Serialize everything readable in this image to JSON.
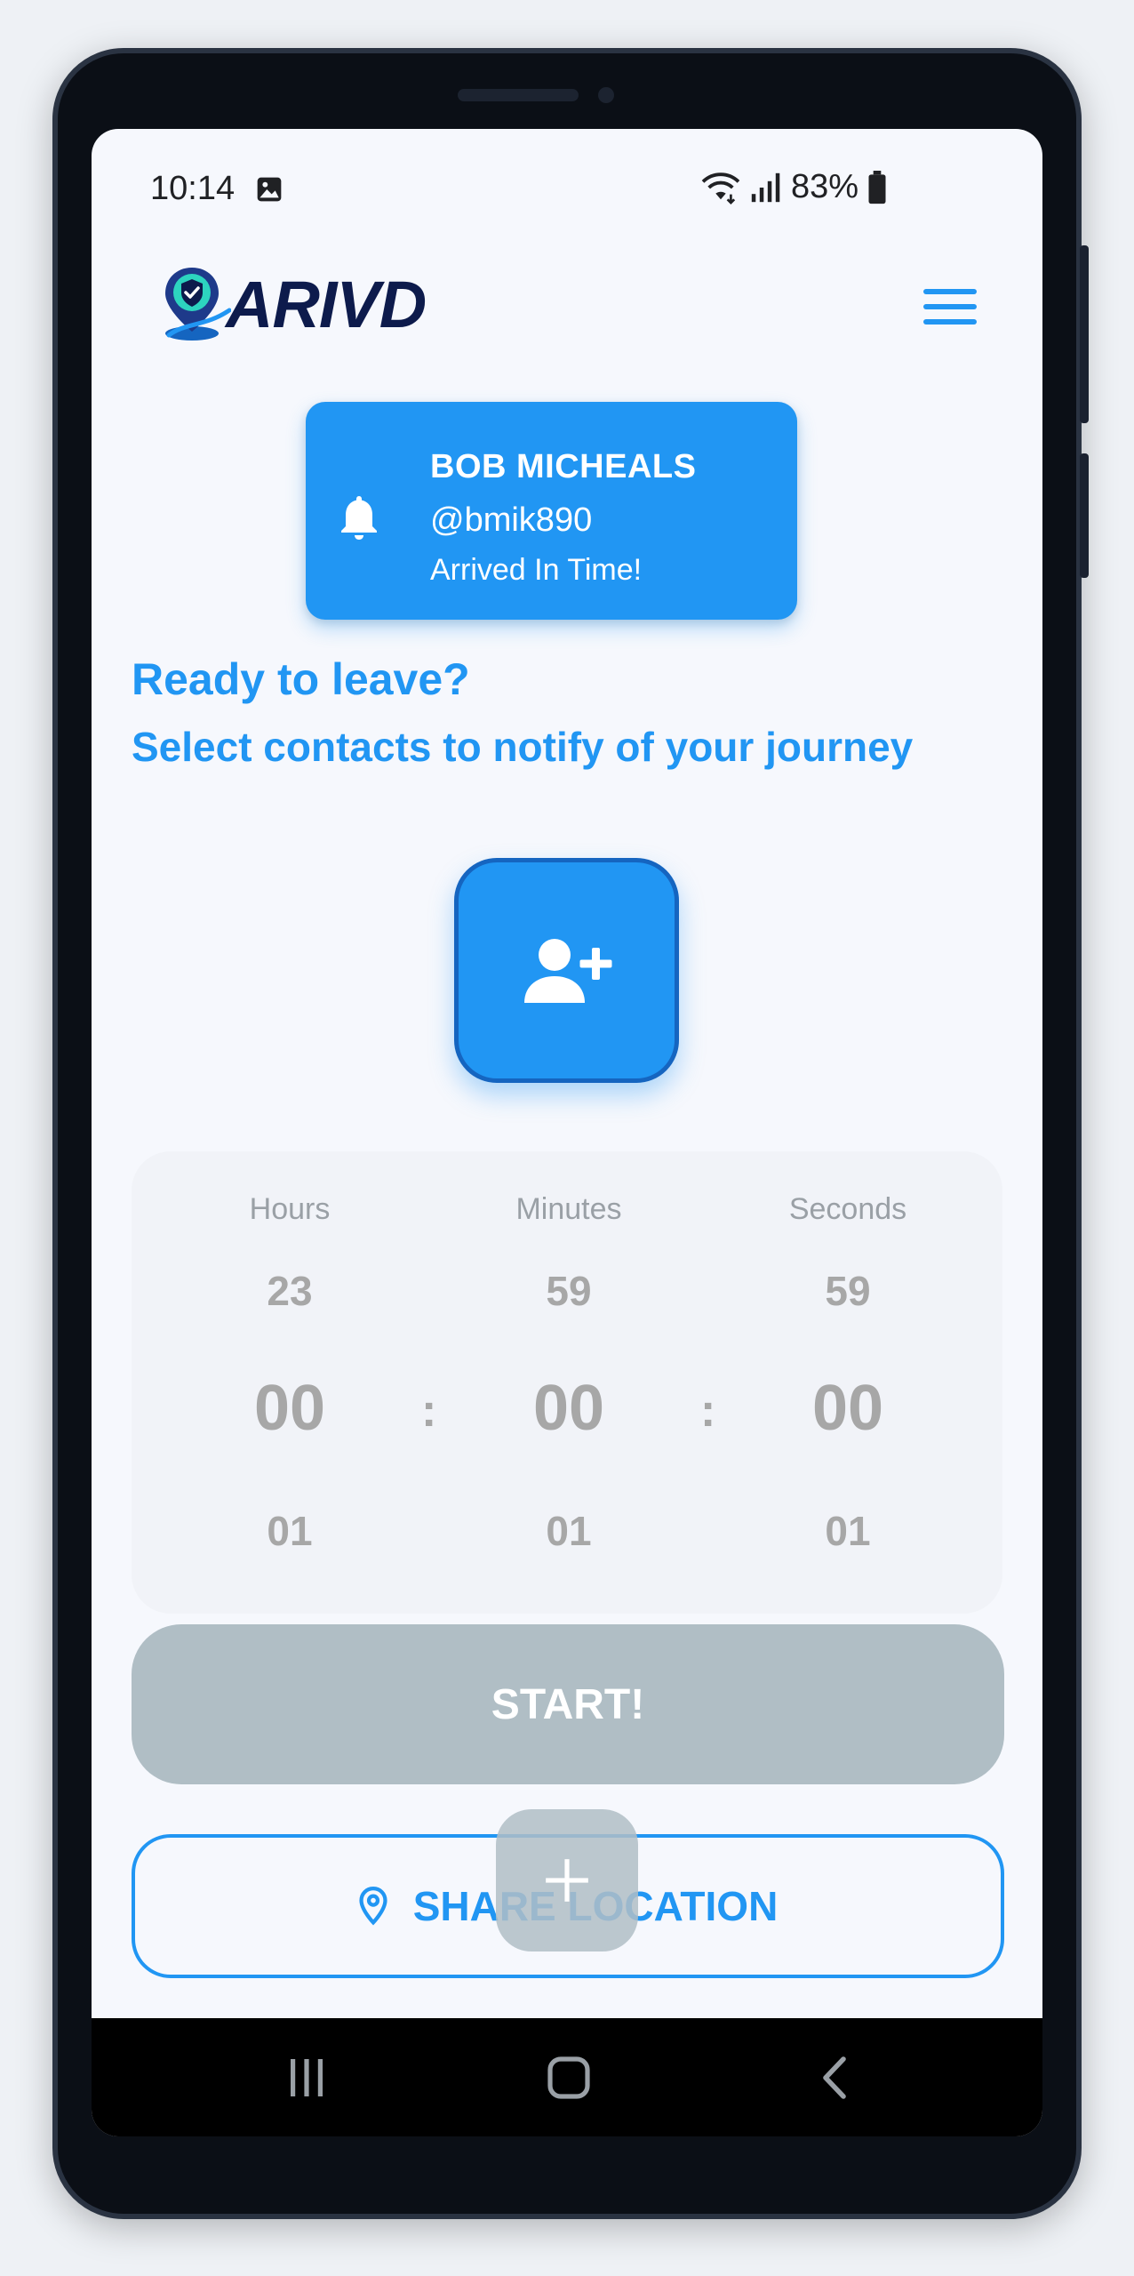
{
  "status_bar": {
    "time": "10:14",
    "battery": "83%",
    "icons": [
      "image-icon",
      "wifi-icon",
      "signal-icon",
      "battery-icon"
    ]
  },
  "app": {
    "logo_text": "ARIVD",
    "menu_icon": "hamburger-menu-icon"
  },
  "notification": {
    "name": "BOB MICHEALS",
    "handle": "@bmik890",
    "status": "Arrived In Time!",
    "icon": "bell-icon"
  },
  "main": {
    "heading": "Ready to leave?",
    "subheading": "Select contacts to notify of your journey",
    "add_contact_icon": "person-add-icon"
  },
  "timer": {
    "columns": [
      {
        "label": "Hours",
        "prev": "23",
        "current": "00",
        "next": "01"
      },
      {
        "label": "Minutes",
        "prev": "59",
        "current": "00",
        "next": "01"
      },
      {
        "label": "Seconds",
        "prev": "59",
        "current": "00",
        "next": "01"
      }
    ],
    "separator": ":"
  },
  "actions": {
    "start_label": "START!",
    "share_label": "SHARE LOCATION",
    "share_icon": "location-pin-icon",
    "fab_icon": "plus-icon"
  },
  "nav_bar": {
    "items": [
      "recents-icon",
      "home-icon",
      "back-icon"
    ]
  },
  "colors": {
    "primary": "#2196f3",
    "primary_dark": "#1565c0",
    "disabled": "#b0bec5",
    "timer_text": "#a7a7a7",
    "logo_dark": "#0d1b4c"
  }
}
